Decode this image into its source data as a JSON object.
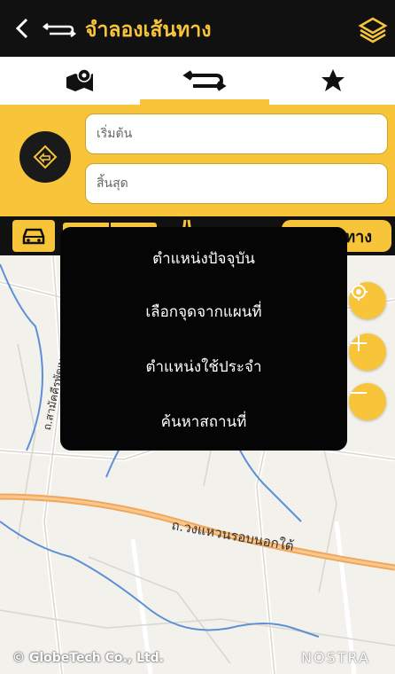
{
  "header": {
    "title": "จำลองเส้นทาง",
    "back_icon": "chevron-left-icon",
    "route_icon": "route-arrows-icon",
    "layers_icon": "layers-icon"
  },
  "tabs": [
    {
      "name": "map-pin-icon",
      "active": false
    },
    {
      "name": "route-arrows-icon",
      "active": true
    },
    {
      "name": "star-icon",
      "active": false
    }
  ],
  "route_form": {
    "start_placeholder": "เริ่มต้น",
    "end_placeholder": "สิ้นสุด",
    "swap_icon": "swap-icon"
  },
  "mode_bar": {
    "car_icon": "car-icon",
    "toll_icon": "toll-road-icon",
    "search_label": "ทาง"
  },
  "map": {
    "road_label": "ถ.วงแหวนรอบนอกใต้",
    "side_road_label": "ถ.สามัคคีรพัฒนา",
    "copyright": "© GlobeTech Co., Ltd.",
    "brand": "NOSTRA",
    "controls": [
      "locate-icon",
      "zoom-in-icon",
      "zoom-out-icon"
    ]
  },
  "popup_menu": {
    "items": [
      "ตำแหน่งปัจจุบัน",
      "เลือกจุดจากแผนที่",
      "ตำแหน่งใช้ประจำ",
      "ค้นหาสถานที่"
    ]
  },
  "colors": {
    "accent": "#f7c43a",
    "dark": "#111111",
    "road_orange": "#f2a65a",
    "river_blue": "#5b8fd6"
  }
}
